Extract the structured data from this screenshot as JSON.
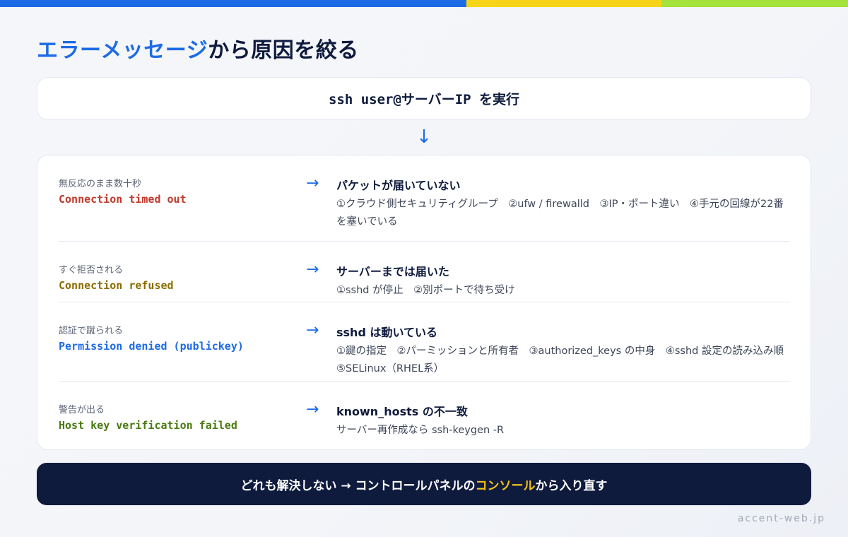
{
  "colors": {
    "accent": "#1e6be6",
    "navy": "#0f1b3d",
    "highlight": "#f7c21a",
    "stripe": [
      "#1e6be6",
      "#f7d417",
      "#a3e33c"
    ]
  },
  "title": {
    "accent": "エラーメッセージ",
    "rest": "から原因を絞る"
  },
  "command": "ssh user@サーバーIP を実行",
  "flow_arrow": "↓",
  "rows": [
    {
      "symptom": "無反応のまま数十秒",
      "error": "Connection timed out",
      "error_color": "#c0392b",
      "arrow": "→",
      "diagnosis": "パケットが届いていない",
      "causes": "①クラウド側セキュリティグループ　②ufw / firewalld　③IP・ポート違い　④手元の回線が22番を塞いでいる"
    },
    {
      "symptom": "すぐ拒否される",
      "error": "Connection refused",
      "error_color": "#8a6d00",
      "arrow": "→",
      "diagnosis": "サーバーまでは届いた",
      "causes": "①sshd が停止　②別ポートで待ち受け"
    },
    {
      "symptom": "認証で蹴られる",
      "error": "Permission denied (publickey)",
      "error_color": "#1e6be6",
      "arrow": "→",
      "diagnosis": "sshd は動いている",
      "causes": "①鍵の指定　②パーミッションと所有者　③authorized_keys の中身　④sshd 設定の読み込み順　⑤SELinux（RHEL系）"
    },
    {
      "symptom": "警告が出る",
      "error": "Host key verification failed",
      "error_color": "#4a7a12",
      "arrow": "→",
      "diagnosis": "known_hosts の不一致",
      "causes": "サーバー再作成なら ssh-keygen -R"
    }
  ],
  "bottom": {
    "before": "どれも解決しない → コントロールパネルの",
    "highlight": "コンソール",
    "after": "から入り直す"
  },
  "footer": "accent-web.jp"
}
